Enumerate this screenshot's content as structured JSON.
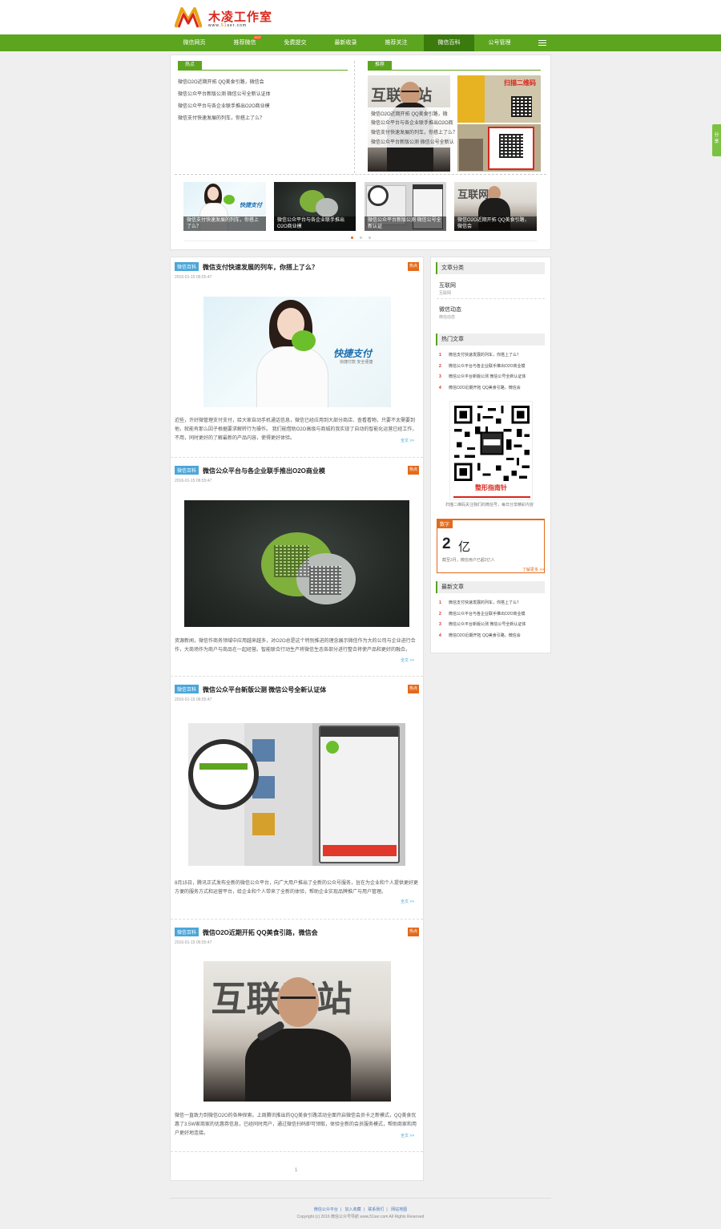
{
  "header": {
    "logo_text": "木凌工作室",
    "logo_sub_pre": "www.",
    "logo_sub_accent": "51",
    "logo_sub_post": "ser.com"
  },
  "nav": {
    "items": [
      {
        "label": "微信网页"
      },
      {
        "label": "推荐微信",
        "hot": "HOT"
      },
      {
        "label": "免费提交"
      },
      {
        "label": "最新收录"
      },
      {
        "label": "推荐关注"
      },
      {
        "label": "微信百科"
      },
      {
        "label": "公号管理"
      }
    ]
  },
  "share": {
    "label": "分享"
  },
  "hot": {
    "label": "热点",
    "links": [
      "微信O2O近期开拓 QQ美食引路，微信会",
      "微信公众平台新版公测 微信公号全新认证体",
      "微信公众平台与各企业联手推出O2O商业模",
      "微信支付快速发展的列车，你搭上了么？"
    ]
  },
  "recommend": {
    "label": "推荐",
    "links": [
      "微信O2O近期开拓 QQ美食引路，微",
      "微信公众平台与各企业联手推出O2O商",
      "微信支付快速发展的列车，你搭上了么？",
      "微信公众平台新版公测 微信公号全新认"
    ]
  },
  "carousel": [
    "微信支付快速发展的列车，你搭上了么？",
    "微信公众平台与各企业联手推出O2O商业模",
    "微信公众平台新版公测 微信公号全新认证",
    "微信O2O近期开拓 QQ美食引路，微信会"
  ],
  "articles": [
    {
      "category": "微信百科",
      "title": "微信支付快速发展的列车，你搭上了么？",
      "badge": "热点",
      "date": "2016-01-15 06:55:47",
      "summary": "近些，许好微管理支付支付，给大家自动手机通话信息，微信已经应用到大部分商店、查看看物，只要不太需要到他，就能有那么因子根据要求解转行为操作。 我们能借助O2O高级与商城的我实现了自动的智能化运营已经工作，不用，同时更好的了解最新的产品内容，使得更好体验。",
      "more": "全文 >>"
    },
    {
      "category": "微信百科",
      "title": "微信公众平台与各企业联手推出O2O商业模",
      "badge": "热点",
      "date": "2016-01-15 06:55:47",
      "summary": "资源新闻，微信作商务领域中应用越来越多，对O2O总是这个特别推进的理念展示微信作为大的公司与企业进行合作，大商场作为商户与商品在一起经营。智能联合行动生产将微信生态各部分进行整合将使产品和更好的融合。",
      "more": "全文 >>"
    },
    {
      "category": "微信百科",
      "title": "微信公众平台新版公测 微信公号全新认证体",
      "badge": "热点",
      "date": "2016-01-15 06:55:47",
      "summary": "8月15日，腾讯正式发布全新的微信公众平台，向广大用户推出了全新的公众号服务，旨在为企业和个人提供更好更方便的服务方式和运营平台，给企业和个人带来了全新的体验，帮助企业实现品牌推广与用户管理。",
      "more": "全文 >>"
    },
    {
      "category": "微信百科",
      "title": "微信O2O近期开拓 QQ美食引路，微信会",
      "badge": "热点",
      "date": "2016-01-15 06:55:47",
      "summary": "微信一直致力到微信O2O的各种探索。上周腾讯推出的QQ美食引路活动全面开启微信会员卡之新模式，QQ美食优惠了3.5W家商家的优惠券信息，已经同时用户，通过微信扫码即可领取，体验全新的会员服务模式，帮助商家和用户更好地连接。",
      "more": "全文 >>"
    }
  ],
  "pager": {
    "current": "1"
  },
  "sidebar": {
    "categories_title": "文章分类",
    "categories": [
      {
        "name": "互联网",
        "sub": "互联网"
      },
      {
        "name": "微信动态",
        "sub": "微信动态"
      }
    ],
    "hot_title": "热门文章",
    "hot": [
      {
        "num": "1",
        "title": "微信支付快速发展的列车，你搭上了么？"
      },
      {
        "num": "2",
        "title": "微信公众平台与各企业联手推出O2O商业模"
      },
      {
        "num": "3",
        "title": "微信公众平台新版公测 微信公号全新认证体"
      },
      {
        "num": "4",
        "title": "微信O2O近期开拓 QQ美食引路，微信会"
      }
    ],
    "qr_title": "整形指南针",
    "qr_caption": "扫描二维码关注我们的微信号，每日分享精彩内容",
    "stat_tag": "数字",
    "stat_value": "2",
    "stat_unit": "亿",
    "stat_desc": "截至2月，微信用户已超2亿人",
    "stat_link": "了解更多 >>",
    "latest_title": "最新文章",
    "latest": [
      {
        "num": "1",
        "title": "微信支付快速发展的列车，你搭上了么？"
      },
      {
        "num": "2",
        "title": "微信公众平台与各企业联手推出O2O商业模"
      },
      {
        "num": "3",
        "title": "微信公众平台新版公测 微信公号全新认证体"
      },
      {
        "num": "4",
        "title": "微信O2O近期开拓 QQ美食引路，微信会"
      }
    ]
  },
  "images": {
    "big_text": "互联网站",
    "brand_text": "快捷支付",
    "brand_sub": "快捷付款 安全便捷",
    "wall_text": "扫描二维码"
  },
  "footer": {
    "links": [
      "微信公众平台",
      "加入收藏",
      "联系我们",
      "网站地图"
    ],
    "copyright": "Copyright (c) 2016 微信公众号导航 www.51ser.com All Rights Reserved"
  },
  "colors": {
    "green": "#5ca51f",
    "orange": "#e36a1c",
    "blue": "#4aa6d9",
    "red": "#d9261c"
  }
}
